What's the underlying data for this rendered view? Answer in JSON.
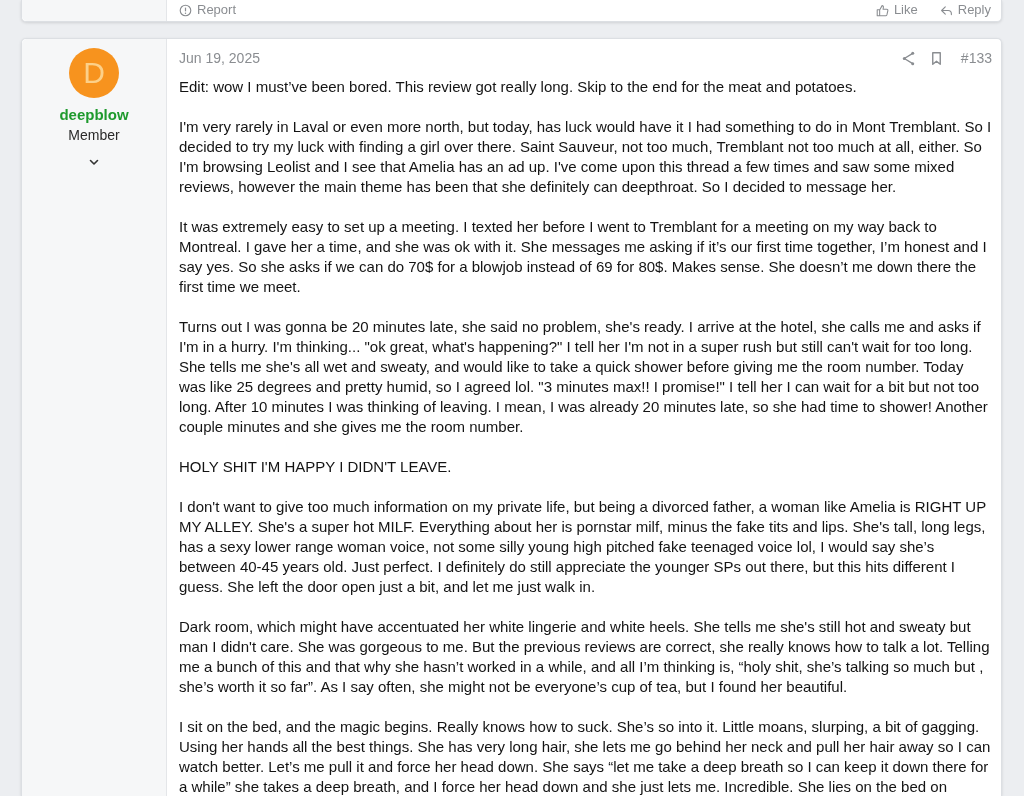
{
  "previous_post": {
    "actions_left": [
      {
        "kind": "report",
        "label": "Report"
      }
    ],
    "actions_right": [
      {
        "kind": "like",
        "label": "Like"
      },
      {
        "kind": "reply",
        "label": "Reply"
      }
    ]
  },
  "post": {
    "user": {
      "avatar_letter": "D",
      "name": "deepblow",
      "role": "Member"
    },
    "date": "Jun 19, 2025",
    "number": "#133",
    "paragraphs": [
      "Edit: wow I must’ve been bored. This review got really long. Skip to the end for the meat and potatoes.",
      "I'm very rarely in Laval or even more north, but today, has luck would have it I had something to do in Mont Tremblant. So I decided to try my luck with finding a girl over there. Saint Sauveur, not too much, Tremblant not too much at all, either. So I'm browsing Leolist and I see that Amelia has an ad up. I've come upon this thread a few times and saw some mixed reviews, however the main theme has been that she definitely can deepthroat. So I decided to message her.",
      "It was extremely easy to set up a meeting. I texted her before I went to Tremblant for a meeting on my way back to Montreal. I gave her a time, and she was ok with it. She messages me asking if it’s our first time together, I’m honest and I say yes. So she asks if we can do 70$ for a blowjob instead of 69 for 80$. Makes sense. She doesn’t me down there the first time we meet.",
      "Turns out I was gonna be 20 minutes late, she said no problem, she's ready. I arrive at the hotel, she calls me and asks if I'm in a hurry. I'm thinking... \"ok great, what's happening?\" I tell her I'm not in a super rush but still can't wait for too long. She tells me she's all wet and sweaty, and would like to take a quick shower before giving me the room number. Today was like 25 degrees and pretty humid, so I agreed lol. \"3 minutes max!! I promise!\" I tell her I can wait for a bit but not too long. After 10 minutes I was thinking of leaving. I mean, I was already 20 minutes late, so she had time to shower! Another couple minutes and she gives me the room number.",
      "HOLY SHIT I'M HAPPY I DIDN'T LEAVE.",
      "I don't want to give too much information on my private life, but being a divorced father, a woman like Amelia is RIGHT UP MY ALLEY. She's a super hot MILF. Everything about her is pornstar milf, minus the fake tits and lips. She's tall, long legs, has a sexy lower range woman voice, not some silly young high pitched fake teenaged voice lol, I would say she’s between 40-45 years old. Just perfect. I definitely do still appreciate the younger SPs out there, but this hits different I guess. She left the door open just a bit, and let me just walk in.",
      "Dark room, which might have accentuated her white lingerie and white heels. She tells me she's still hot and sweaty but man I didn't care. She was gorgeous to me. But the previous reviews are correct, she really knows how to talk a lot. Telling me a bunch of this and that why she hasn’t worked in a while, and all I’m thinking is, “holy shit, she’s talking so much but , she’s worth it so far”. As I say often, she might not be everyone’s cup of tea, but I found her beautiful.",
      "I sit on the bed, and the magic begins. Really knows how to suck. She’s so into it. Little moans, slurping, a bit of gagging. Using her hands all the best things. She has very long hair, she lets me go behind her neck and pull her hair away so I can watch better. Let’s me pull it and force her head down. She says “let me take a deep breath so I can keep it down there for a while” she takes a deep breath, and I force her head down and she just lets me. Incredible. She lies on the bed on"
    ]
  }
}
